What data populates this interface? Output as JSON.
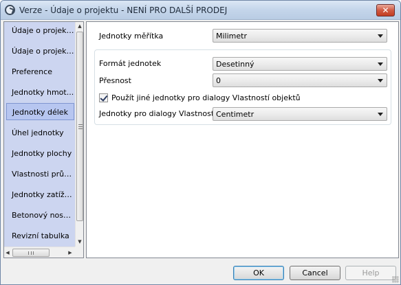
{
  "window": {
    "title": "Verze - Údaje o projektu - NENÍ PRO DALŠÍ PRODEJ",
    "close_glyph": "✕"
  },
  "sidebar": {
    "items": [
      {
        "label": "Údaje o projekt..."
      },
      {
        "label": "Údaje o projekt..."
      },
      {
        "label": "Preference"
      },
      {
        "label": "Jednotky hmot..."
      },
      {
        "label": "Jednotky délek",
        "selected": true
      },
      {
        "label": "Úhel jednotky"
      },
      {
        "label": "Jednotky plochy"
      },
      {
        "label": "Vlastnosti průřezu"
      },
      {
        "label": "Jednotky zatížení"
      },
      {
        "label": "Betonový nosník"
      },
      {
        "label": "Revizní tabulka"
      }
    ]
  },
  "settings": {
    "scale_units": {
      "label": "Jednotky měřítka",
      "value": "Milimetr"
    },
    "unit_format": {
      "label": "Formát jednotek",
      "value": "Desetinný"
    },
    "precision": {
      "label": "Přesnost",
      "value": "0"
    },
    "use_other_units": {
      "label": "Použít jiné jednotky pro dialogy Vlastností objektů",
      "checked": true
    },
    "properties_units": {
      "label": "Jednotky pro dialogy Vlastností",
      "value": "Centimetr"
    }
  },
  "buttons": {
    "ok": "OK",
    "cancel": "Cancel",
    "help": "Help"
  }
}
